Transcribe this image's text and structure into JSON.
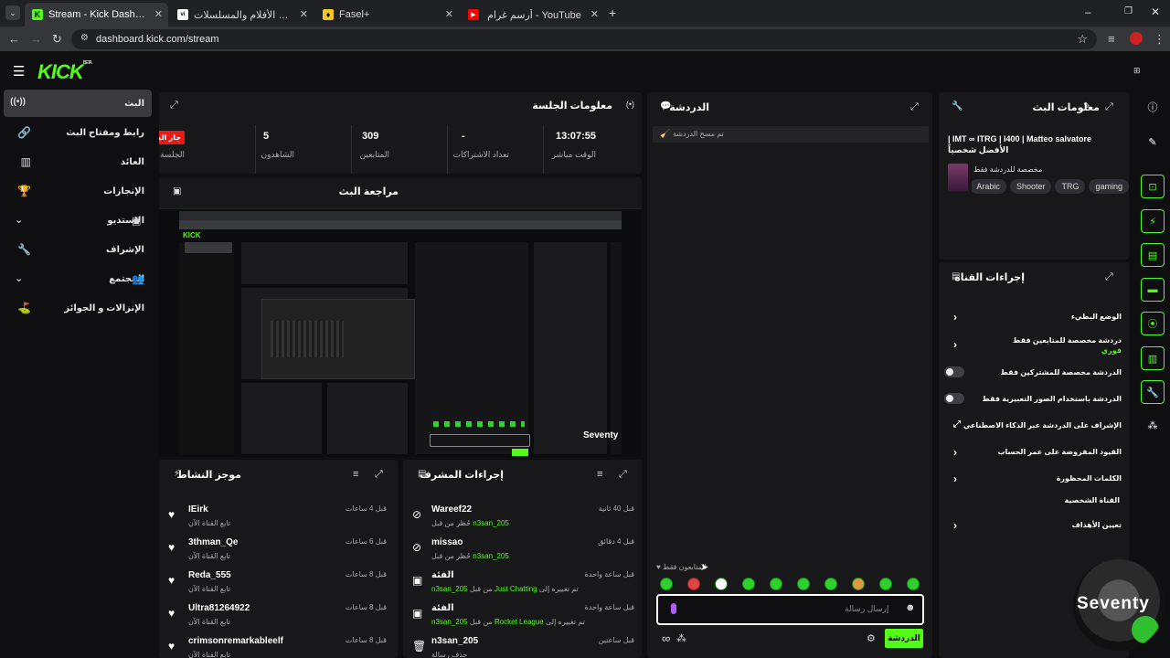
{
  "browser": {
    "tabs": [
      {
        "title": "Stream - Kick Dashboard",
        "active": true,
        "fav": "K"
      },
      {
        "title": "شاهد أفضل الأفلام والمسلسلات",
        "active": false,
        "fav": "vi"
      },
      {
        "title": "Fasel+",
        "active": false,
        "fav": "♦"
      },
      {
        "title": "أرسم غرام - YouTube",
        "active": false,
        "fav": "▶"
      }
    ],
    "url": "dashboard.kick.com/stream"
  },
  "brand": {
    "logo": "KICK",
    "logo_sup": "BETA"
  },
  "sidebar": {
    "items": [
      {
        "label": "البث",
        "icon": "((•))"
      },
      {
        "label": "رابط ومفتاح البث",
        "icon": "⊘"
      },
      {
        "label": "العائد",
        "icon": "▥"
      },
      {
        "label": "الإنجازات",
        "icon": "🏆"
      },
      {
        "label": "الاستديو",
        "icon": "⌄"
      },
      {
        "label": "الإشراف",
        "icon": "🔧"
      },
      {
        "label": "المجتمع",
        "icon": "⌄"
      },
      {
        "label": "الإنزالات و الجوائز",
        "icon": "⛳"
      }
    ]
  },
  "session": {
    "title": "معلومات الجلسة",
    "stats": [
      {
        "value": "13:07:55",
        "label": "الوقت مباشر"
      },
      {
        "value": "-",
        "label": "تعداد الاشتراكات"
      },
      {
        "value": "309",
        "label": "المتابعين"
      },
      {
        "value": "5",
        "label": "الشاهدون"
      },
      {
        "value": "جار البث",
        "label": "الجلسة"
      }
    ]
  },
  "preview": {
    "title": "مراجعة البث",
    "watermark": "Seventy"
  },
  "chat": {
    "title": "الدردشة",
    "cleared": "تم مسح الدردشة",
    "followers_only": "المتابعون فقط",
    "placeholder": "إرسال رسالة",
    "send": "الدردشة"
  },
  "stream_info": {
    "title": "معلومات البث",
    "stream_title": "IMT ∞ ITRG | I400 | Matteo salvatore | الأفضل شخصياً",
    "category": "مخصصة للدردشة فقط",
    "tags": [
      "gaming",
      "TRG",
      "Shooter",
      "Arabic"
    ]
  },
  "channel_actions": {
    "title": "إجراءات القناة",
    "items": [
      {
        "label": "الوضع البطيء",
        "type": "arrow"
      },
      {
        "label": "دردشة مخصصة للمتابعين فقط",
        "sub": "فوري",
        "type": "arrow"
      },
      {
        "label": "الدردشة مخصصة للمشتركين فقط",
        "type": "toggle"
      },
      {
        "label": "الدردشة باستخدام الصور التعبيرية فقط",
        "type": "toggle"
      },
      {
        "label": "الإشراف على الدردشة عبر الذكاء الاصطناعي",
        "type": "ext"
      },
      {
        "label": "القيود المفروضة على عمر الحساب",
        "type": "arrow"
      },
      {
        "label": "الكلمات المحظورة",
        "type": "arrow"
      }
    ],
    "section": "القناة الشخصية",
    "goals": "تعيين الأهداف"
  },
  "mod_actions": {
    "title": "إجراءات المشرف",
    "rows": [
      {
        "name": "Wareef22",
        "time": "قبل 40 ثانية",
        "pre": "حُظر من قبل ",
        "by": "n3san_205",
        "icon": "⊘"
      },
      {
        "name": "missao",
        "time": "قبل 4 دقائق",
        "pre": "حُظر من قبل ",
        "by": "n3san_205",
        "icon": "⊘"
      },
      {
        "name": "الفئة",
        "time": "قبل ساعة واحدة",
        "pre": "تم تغييره إلى ",
        "cat": "Just Chatting",
        "mid": " من قبل ",
        "by": "n3san_205",
        "icon": "▣"
      },
      {
        "name": "الفئة",
        "time": "قبل ساعة واحدة",
        "pre": "تم تغييره إلى ",
        "cat": "Rocket League",
        "mid": " من قبل ",
        "by": "n3san_205",
        "icon": "▣"
      },
      {
        "name": "n3san_205",
        "time": "قبل ساعتين",
        "pre": "حذف رسالة",
        "by": "",
        "icon": "🗑"
      }
    ]
  },
  "activity": {
    "title": "موجز النشاط",
    "rows": [
      {
        "name": "IEirk",
        "time": "قبل 4 ساعات",
        "sub": "تابع القناة الآن"
      },
      {
        "name": "3thman_Qe",
        "time": "قبل 6 ساعات",
        "sub": "تابع القناة الآن"
      },
      {
        "name": "Reda_555",
        "time": "قبل 8 ساعات",
        "sub": "تابع القناة الآن"
      },
      {
        "name": "Ultra81264922",
        "time": "قبل 8 ساعات",
        "sub": "تابع القناة الآن"
      },
      {
        "name": "crimsonremarkableelf",
        "time": "قبل 8 ساعات",
        "sub": "تابع القناة الآن"
      }
    ]
  },
  "overlay": {
    "watermark": "Seventy"
  }
}
